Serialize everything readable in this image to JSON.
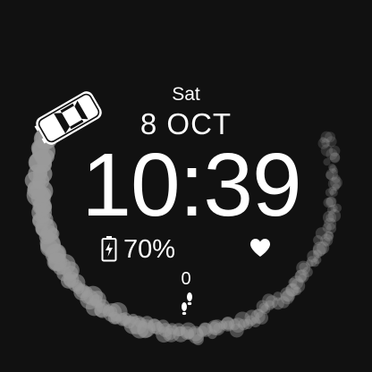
{
  "watch": {
    "day": "Sat",
    "date": "8 OCT",
    "time": "10:39",
    "battery": {
      "percent_text": "70%",
      "level": 0.7
    },
    "steps": {
      "count": "0"
    }
  },
  "icons": {
    "car": "car-icon",
    "battery": "battery-charging-icon",
    "heart": "heart-icon",
    "steps": "footprints-icon"
  },
  "colors": {
    "background": "#111111",
    "foreground": "#ffffff",
    "trail": "#9a9a9a"
  }
}
